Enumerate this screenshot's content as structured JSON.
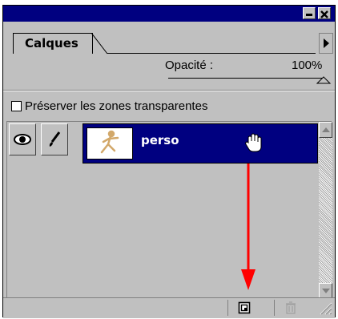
{
  "panel": {
    "tab_label": "Calques",
    "opacity_label": "Opacité :",
    "opacity_value": "100%",
    "preserve_label": "Préserver les zones transparentes",
    "preserve_checked": false
  },
  "layers": [
    {
      "name": "perso",
      "visible": true,
      "editable": true,
      "selected": true
    }
  ],
  "icons": {
    "minimize": "minimize-icon",
    "close": "close-icon",
    "menu": "panel-menu-arrow-icon",
    "eye": "eye-icon",
    "brush": "brush-icon",
    "hand": "hand-cursor-icon",
    "new_layer": "new-layer-icon",
    "trash": "trash-icon",
    "annotation_arrow": "red-arrow-annotation"
  },
  "colors": {
    "titlebar": "#000080",
    "selection": "#000080",
    "panel": "#c0c0c0",
    "annotation": "#ff0000"
  }
}
